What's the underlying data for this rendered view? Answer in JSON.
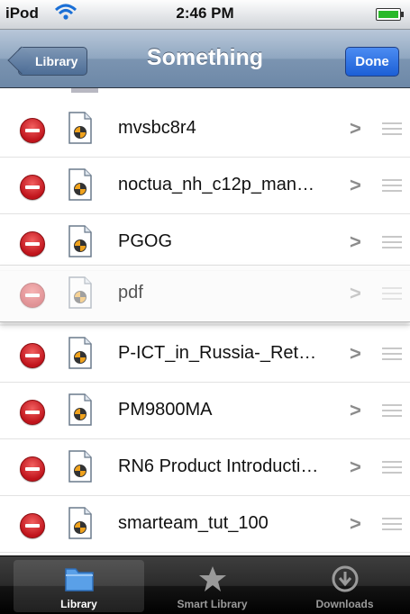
{
  "status_bar": {
    "carrier": "iPod",
    "time": "2:46 PM"
  },
  "nav": {
    "back_label": "Library",
    "title": "Something",
    "done_label": "Done"
  },
  "files": [
    {
      "name": "mvsbc8r4"
    },
    {
      "name": "noctua_nh_c12p_man…"
    },
    {
      "name": "PGOG"
    },
    {
      "name": "pdf",
      "dragging": true
    },
    {
      "name": "P-ICT_in_Russia-_Ret…"
    },
    {
      "name": "PM9800MA"
    },
    {
      "name": "RN6 Product Introducti…"
    },
    {
      "name": "smarteam_tut_100"
    }
  ],
  "tabs": [
    {
      "label": "Library",
      "icon": "folder-icon",
      "selected": true
    },
    {
      "label": "Smart Library",
      "icon": "star-icon",
      "selected": false
    },
    {
      "label": "Downloads",
      "icon": "download-icon",
      "selected": false
    }
  ],
  "colors": {
    "nav_accent": "#6d88a7",
    "done_button": "#1c5fd6",
    "delete": "#c0141c"
  }
}
